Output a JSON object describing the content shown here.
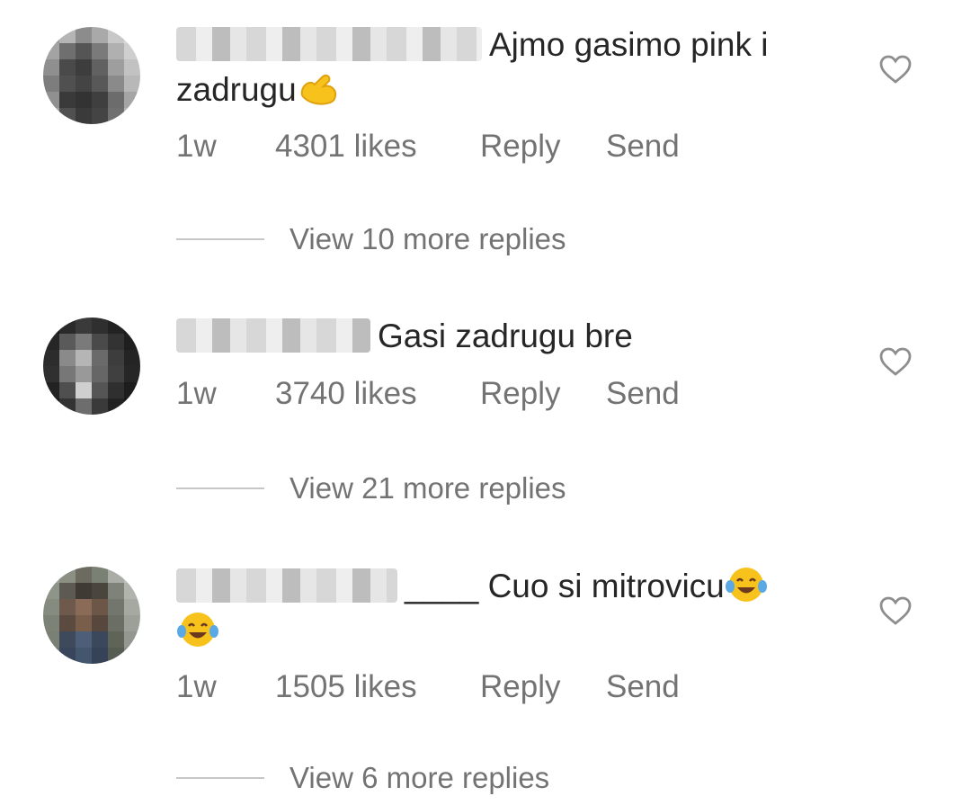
{
  "comments": [
    {
      "text": "Ajmo gasimo pink i zadrugu",
      "emoji": "flexed-biceps",
      "time": "1w",
      "likes": "4301 likes",
      "reply": "Reply",
      "send": "Send",
      "view_replies": "View 10 more replies"
    },
    {
      "text": "Gasi zadrugu bre",
      "time": "1w",
      "likes": "3740 likes",
      "reply": "Reply",
      "send": "Send",
      "view_replies": "View 21 more replies"
    },
    {
      "text": "____ Cuo si mitrovicu",
      "emoji": "tears-of-joy",
      "time": "1w",
      "likes": "1505 likes",
      "reply": "Reply",
      "send": "Send",
      "view_replies": "View 6 more replies"
    }
  ],
  "colors": {
    "text": "#262626",
    "secondary": "#737373",
    "divider": "#c7c7c7"
  }
}
